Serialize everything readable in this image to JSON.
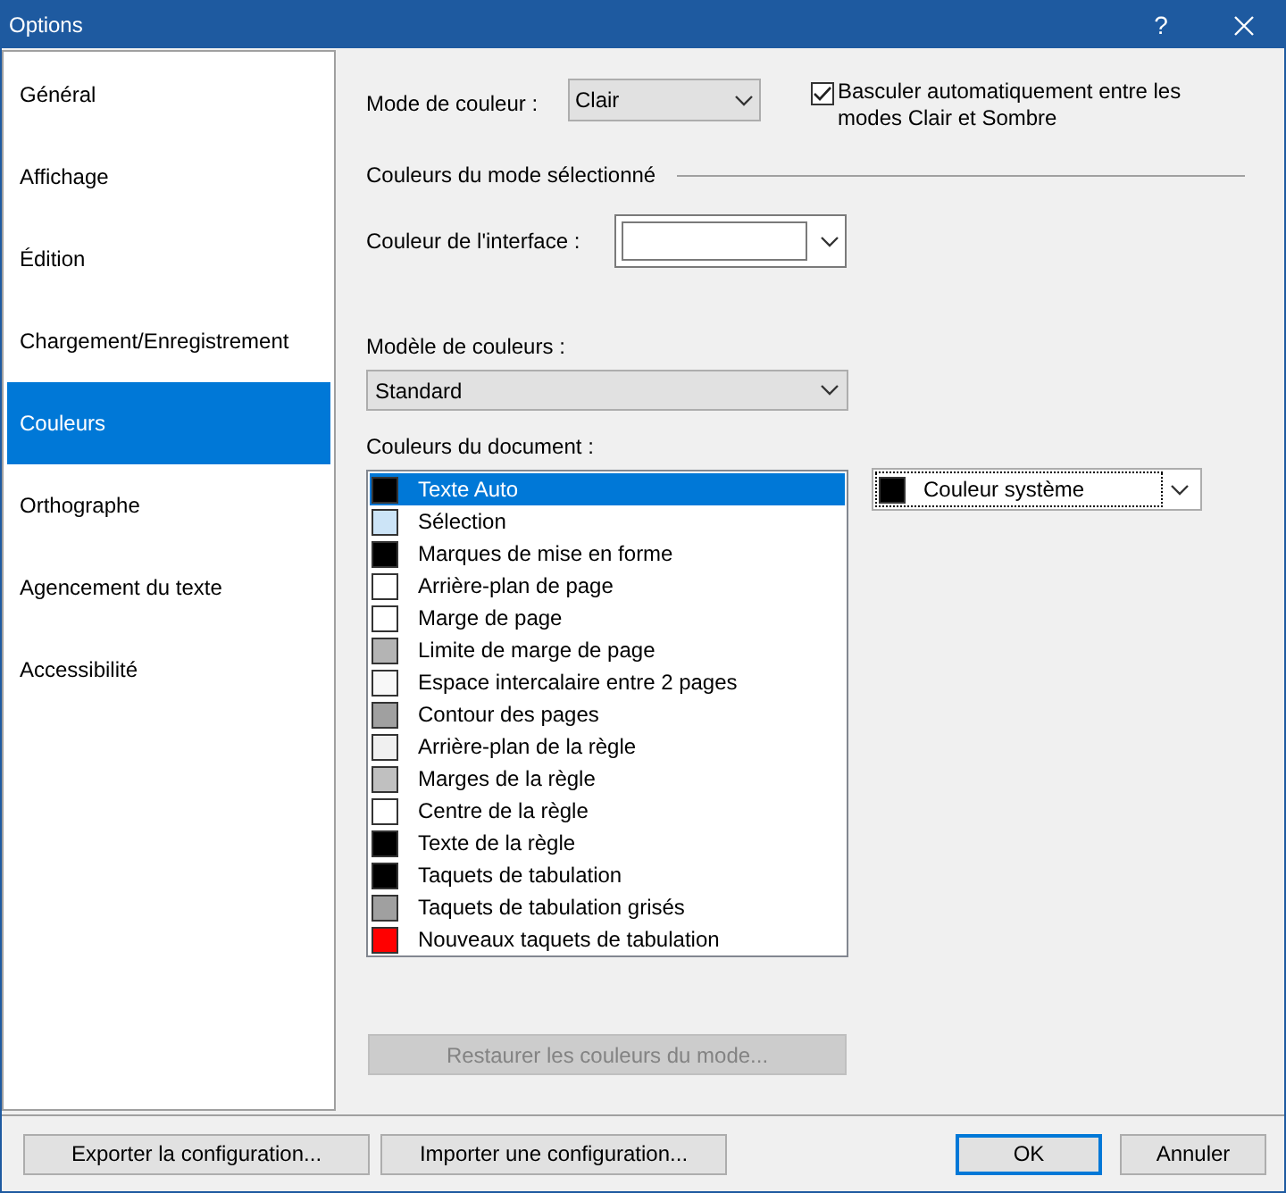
{
  "window": {
    "title": "Options",
    "help": "?"
  },
  "sidebar": {
    "items": [
      {
        "label": "Général",
        "selected": false
      },
      {
        "label": "Affichage",
        "selected": false
      },
      {
        "label": "Édition",
        "selected": false
      },
      {
        "label": "Chargement/Enregistrement",
        "selected": false
      },
      {
        "label": "Couleurs",
        "selected": true
      },
      {
        "label": "Orthographe",
        "selected": false
      },
      {
        "label": "Agencement du texte",
        "selected": false
      },
      {
        "label": "Accessibilité",
        "selected": false
      }
    ]
  },
  "color_mode": {
    "label": "Mode de couleur :",
    "value": "Clair"
  },
  "auto_switch": {
    "label": "Basculer automatiquement entre les modes Clair et Sombre",
    "checked": true
  },
  "section_title": "Couleurs du mode sélectionné",
  "interface_color": {
    "label": "Couleur de l'interface :",
    "color": "#ffffff"
  },
  "color_model": {
    "label": "Modèle de couleurs :",
    "value": "Standard"
  },
  "document_colors": {
    "label": "Couleurs du document :",
    "items": [
      {
        "label": "Texte Auto",
        "color": "#000000",
        "selected": true
      },
      {
        "label": "Sélection",
        "color": "#cce4f7",
        "selected": false
      },
      {
        "label": "Marques de mise en forme",
        "color": "#000000",
        "selected": false
      },
      {
        "label": "Arrière-plan de page",
        "color": "#ffffff",
        "selected": false
      },
      {
        "label": "Marge de page",
        "color": "#ffffff",
        "selected": false
      },
      {
        "label": "Limite de marge de page",
        "color": "#b4b4b4",
        "selected": false
      },
      {
        "label": "Espace intercalaire entre 2 pages",
        "color": "#f8f8f8",
        "selected": false
      },
      {
        "label": "Contour des pages",
        "color": "#a0a0a0",
        "selected": false
      },
      {
        "label": "Arrière-plan de la règle",
        "color": "#f0f0f0",
        "selected": false
      },
      {
        "label": "Marges de la règle",
        "color": "#c0c0c0",
        "selected": false
      },
      {
        "label": "Centre de la règle",
        "color": "#ffffff",
        "selected": false
      },
      {
        "label": "Texte de la règle",
        "color": "#000000",
        "selected": false
      },
      {
        "label": "Taquets de tabulation",
        "color": "#000000",
        "selected": false
      },
      {
        "label": "Taquets de tabulation grisés",
        "color": "#a0a0a0",
        "selected": false
      },
      {
        "label": "Nouveaux taquets de tabulation",
        "color": "#ff0000",
        "selected": false
      }
    ]
  },
  "selected_color": {
    "label": "Couleur système",
    "color": "#000000"
  },
  "restore_button": {
    "label": "Restaurer les couleurs du mode...",
    "disabled": true
  },
  "footer_buttons": [
    {
      "label": "Exporter la configuration...",
      "default": false
    },
    {
      "label": "Importer une configuration...",
      "default": false
    },
    {
      "label": "OK",
      "default": true
    },
    {
      "label": "Annuler",
      "default": false
    }
  ]
}
